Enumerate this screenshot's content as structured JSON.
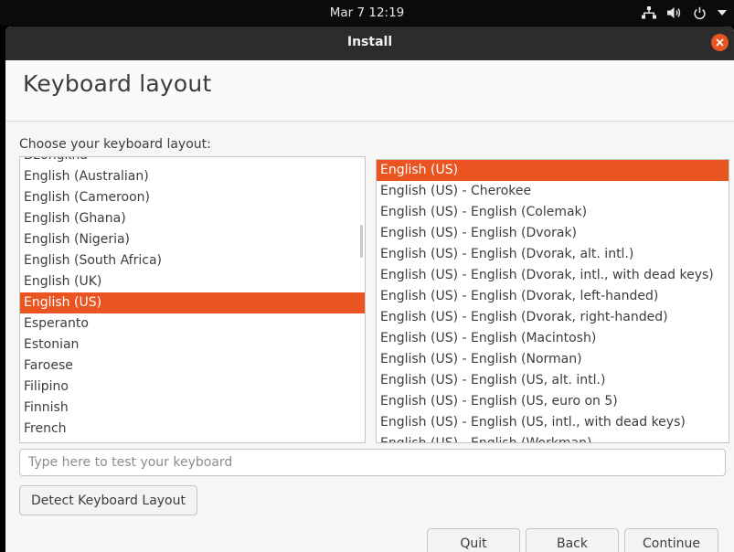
{
  "topbar": {
    "clock": "Mar 7  12:19",
    "icons": [
      "network-icon",
      "volume-icon",
      "power-icon",
      "chevron-down-icon"
    ]
  },
  "window": {
    "title": "Install",
    "close_icon": "close-icon"
  },
  "page": {
    "title": "Keyboard layout",
    "choose_label": "Choose your keyboard layout:"
  },
  "layouts": {
    "items": [
      "Dzongkha",
      "English (Australian)",
      "English (Cameroon)",
      "English (Ghana)",
      "English (Nigeria)",
      "English (South Africa)",
      "English (UK)",
      "English (US)",
      "Esperanto",
      "Estonian",
      "Faroese",
      "Filipino",
      "Finnish",
      "French"
    ],
    "selected": "English (US)"
  },
  "variants": {
    "items": [
      "English (US)",
      "English (US) - Cherokee",
      "English (US) - English (Colemak)",
      "English (US) - English (Dvorak)",
      "English (US) - English (Dvorak, alt. intl.)",
      "English (US) - English (Dvorak, intl., with dead keys)",
      "English (US) - English (Dvorak, left-handed)",
      "English (US) - English (Dvorak, right-handed)",
      "English (US) - English (Macintosh)",
      "English (US) - English (Norman)",
      "English (US) - English (US, alt. intl.)",
      "English (US) - English (US, euro on 5)",
      "English (US) - English (US, intl., with dead keys)",
      "English (US) - English (Workman)"
    ],
    "selected": "English (US)"
  },
  "test_input": {
    "placeholder": "Type here to test your keyboard",
    "value": ""
  },
  "buttons": {
    "detect": "Detect Keyboard Layout",
    "quit": "Quit",
    "back": "Back",
    "continue": "Continue"
  },
  "colors": {
    "accent": "#e95420",
    "titlebar": "#2c2c2c",
    "topbar": "#0b0b0b"
  }
}
